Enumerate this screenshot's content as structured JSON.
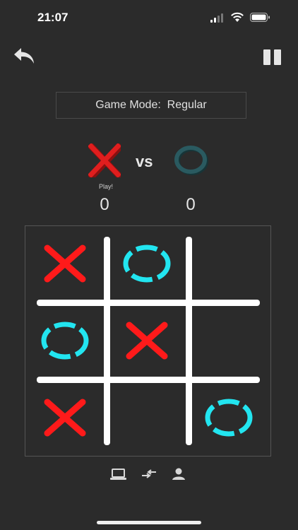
{
  "status_bar": {
    "time": "21:07"
  },
  "game_mode": {
    "label": "Game Mode:",
    "value": "Regular"
  },
  "players": {
    "x": {
      "symbol": "X",
      "score": "0",
      "turn_label": "Play!",
      "color": "#e01e1e"
    },
    "vs_label": "vs",
    "o": {
      "symbol": "O",
      "score": "0",
      "color": "#2a5a60"
    }
  },
  "board": {
    "x_color": "#ff1a1a",
    "o_color": "#22e5f0",
    "cells": [
      "X",
      "O",
      "",
      "O",
      "X",
      "",
      "X",
      "",
      "O"
    ]
  },
  "icons": {
    "undo": "undo-arrow-icon",
    "pause": "pause-icon",
    "computer": "laptop-icon",
    "swap": "swap-arrows-icon",
    "human": "person-icon"
  }
}
